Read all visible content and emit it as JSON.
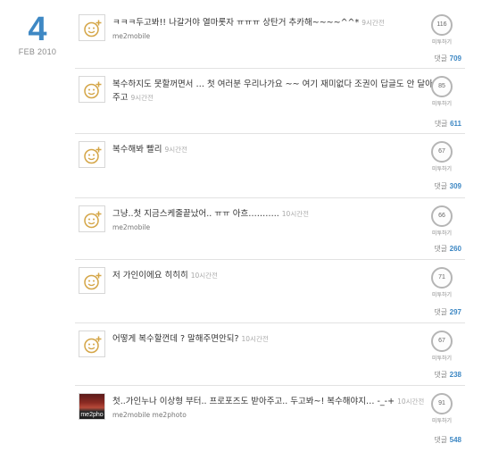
{
  "date": {
    "day": "4",
    "month_year": "FEB 2010"
  },
  "labels": {
    "metoo": "미투하기",
    "comments": "댓글"
  },
  "posts": [
    {
      "text": "ㅋㅋㅋ두고봐!! 나갈거야 열마롯자 ㅠㅠㅠ 상탄거 추카해~~~~^^*",
      "time": "9시간전",
      "author": "me2mobile",
      "metoo": "116",
      "comments": "709",
      "avatar": "smile-icon"
    },
    {
      "text": "복수하지도 못할꺼면서 … 첫 여러분 우리나가요 ~~ 여기 재미없다 조권이 답글도 안 달아주고",
      "time": "9시간전",
      "author": "",
      "metoo": "85",
      "comments": "611",
      "avatar": "smile-icon"
    },
    {
      "text": "복수해봐 빨리",
      "time": "9시간전",
      "author": "",
      "metoo": "67",
      "comments": "309",
      "avatar": "smile-icon"
    },
    {
      "text": "그냥..첫 지금스케줄끝났어.. ㅠㅠ 아흐………..",
      "time": "10시간전",
      "author": "me2mobile",
      "metoo": "66",
      "comments": "260",
      "avatar": "smile-icon"
    },
    {
      "text": "저 가인이에요 히히히",
      "time": "10시간전",
      "author": "",
      "metoo": "71",
      "comments": "297",
      "avatar": "smile-icon"
    },
    {
      "text": "어떻게 복수할껀데 ? 말해주면안되?",
      "time": "10시간전",
      "author": "",
      "metoo": "67",
      "comments": "238",
      "avatar": "smile-icon"
    },
    {
      "text": "첫..가인누나 이상형 부터.. 프로포즈도 받아주고.. 두고봐~! 복수해야지… -_-+",
      "time": "10시간전",
      "author": "me2mobile me2photo",
      "metoo": "91",
      "comments": "548",
      "avatar": "photo",
      "avatar_text": "me2pho"
    }
  ]
}
